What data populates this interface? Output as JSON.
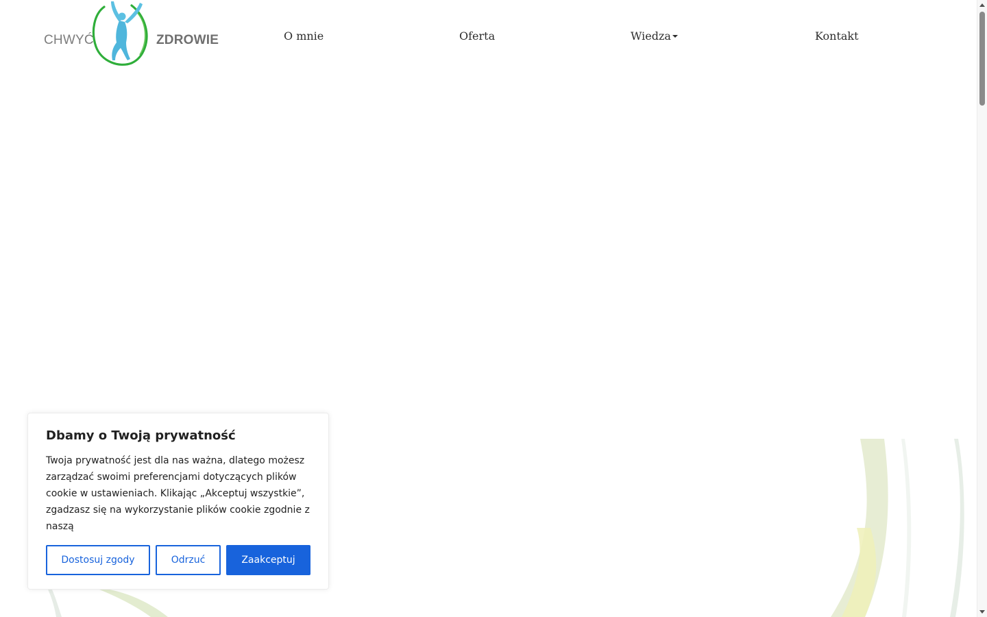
{
  "brand": {
    "word_left": "CHWYĆ",
    "word_right": "ZDROWIE",
    "colors": {
      "figure": "#4fb6dc",
      "ring": "#2fae3a",
      "text": "#6f6f6f"
    }
  },
  "nav": {
    "items": [
      {
        "label": "O mnie"
      },
      {
        "label": "Oferta"
      },
      {
        "label": "Wiedza",
        "has_dropdown": true,
        "icon": "caret-down-icon"
      },
      {
        "label": "Kontakt"
      }
    ]
  },
  "cookie_banner": {
    "title": "Dbamy o Twoją prywatność",
    "body": "Twoja prywatność jest dla nas ważna, dlatego możesz zarządzać swoimi preferencjami dotyczących plików cookie w ustawieniach. Klikając „Akceptuj wszystkie”, zgadzasz się na wykorzystanie plików cookie zgodnie z naszą",
    "buttons": {
      "customize": "Dostosuj zgody",
      "reject": "Odrzuć",
      "accept": "Zaakceptuj"
    },
    "colors": {
      "accent": "#1863dc"
    }
  }
}
